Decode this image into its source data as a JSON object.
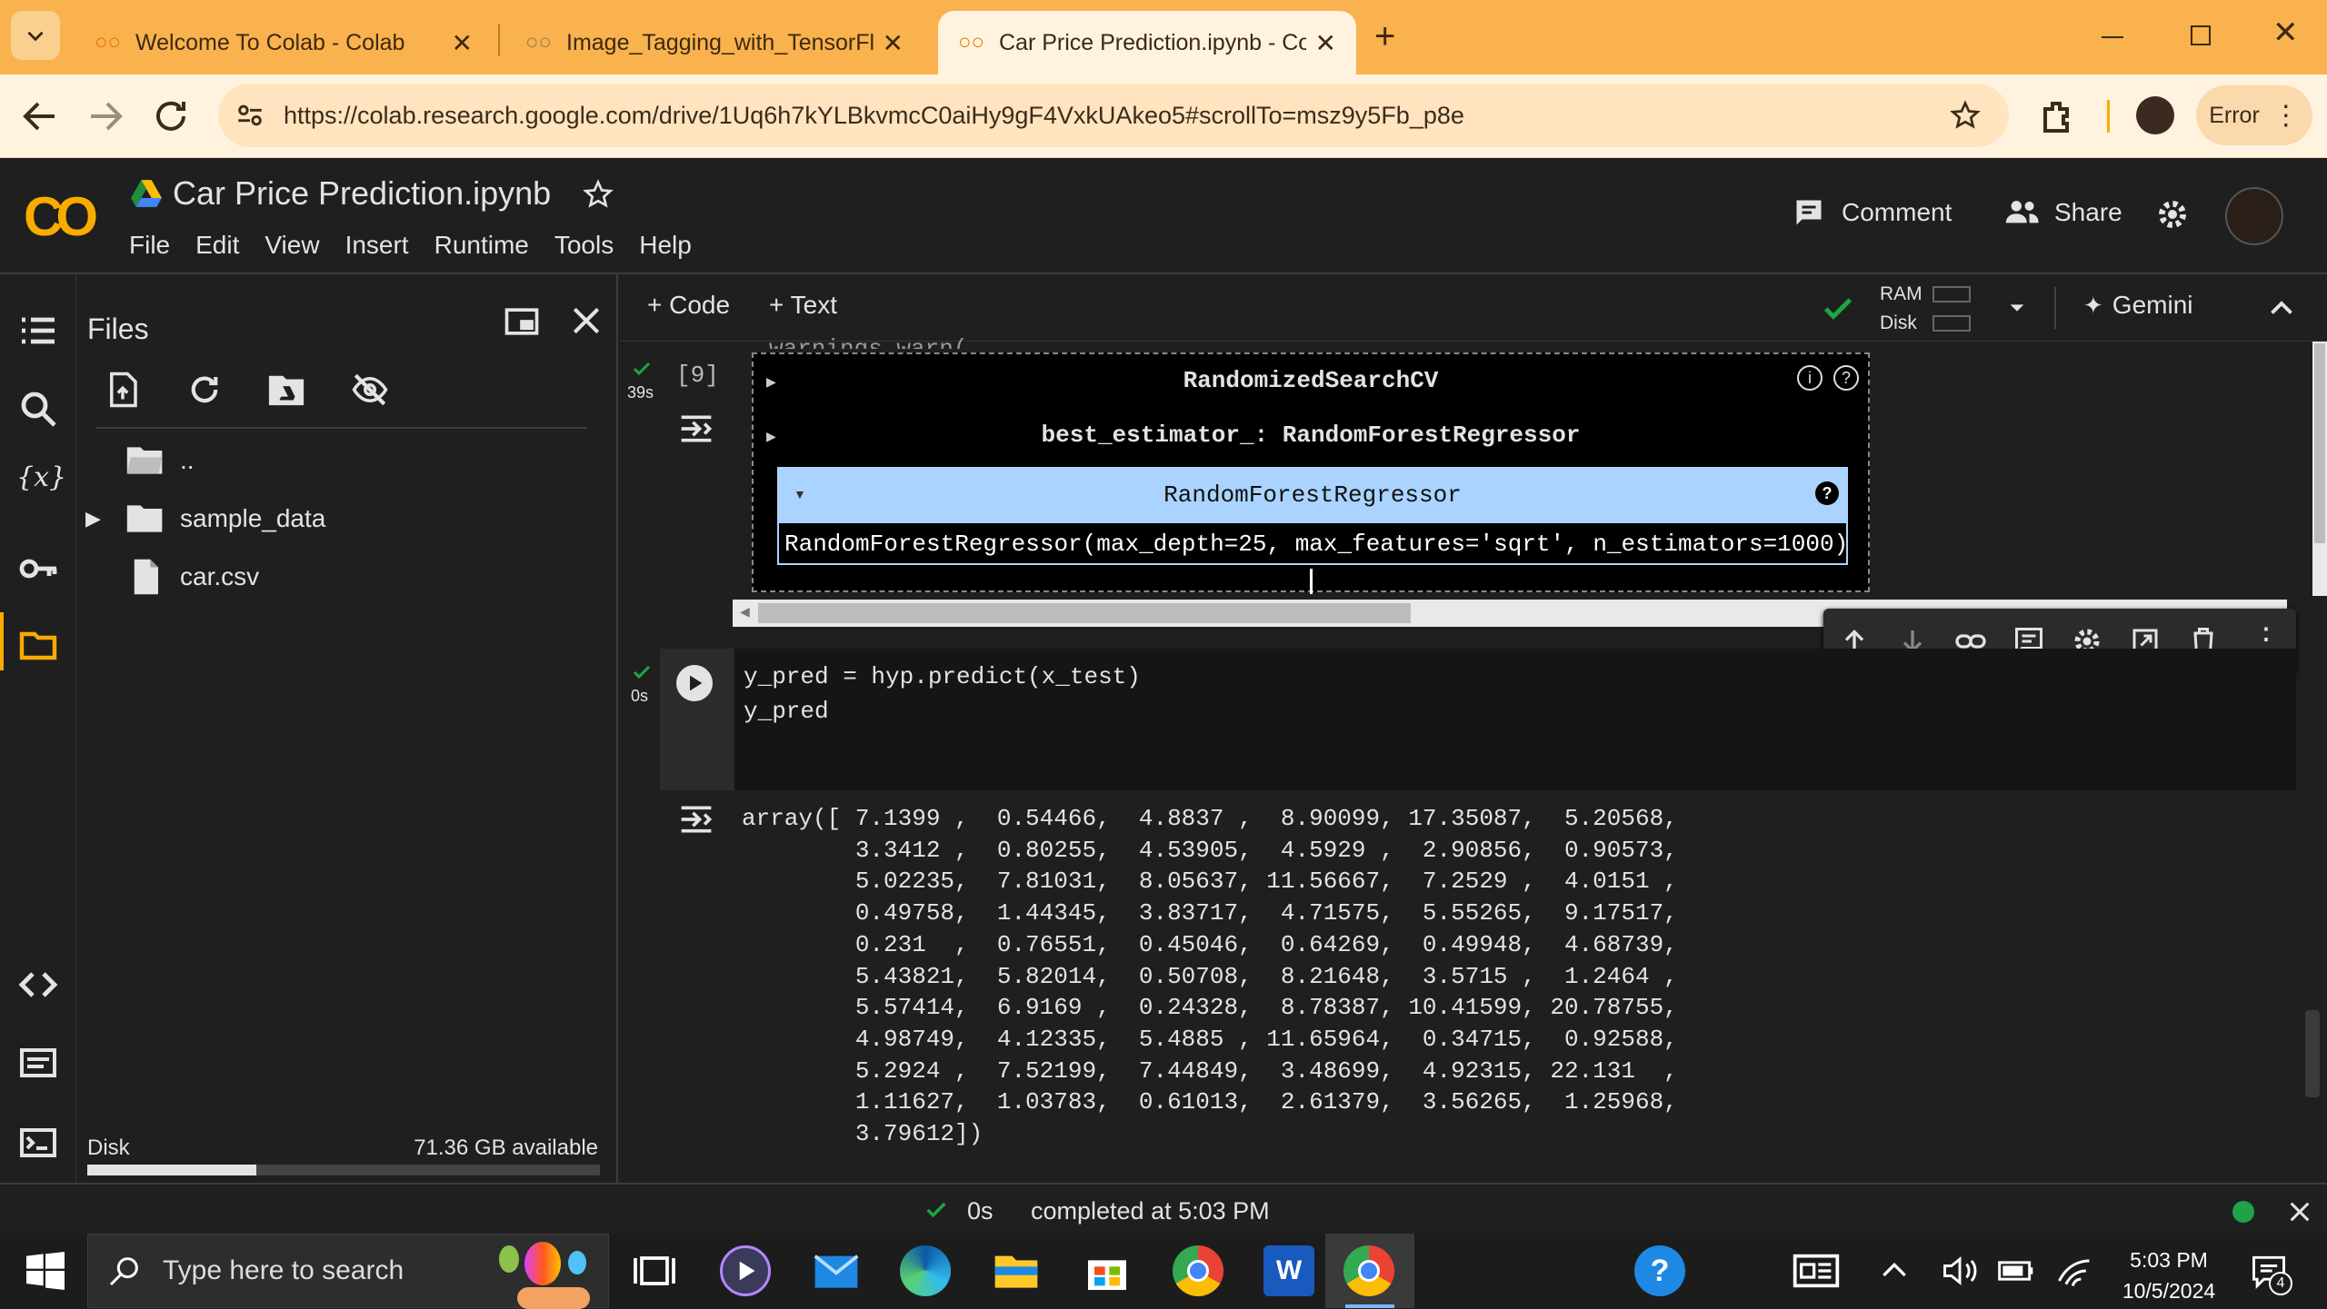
{
  "browser": {
    "tabs": [
      {
        "title": "Welcome To Colab - Colab"
      },
      {
        "title": "Image_Tagging_with_TensorFlow"
      },
      {
        "title": "Car Price Prediction.ipynb - Colab",
        "active": true
      }
    ],
    "url": "https://colab.research.google.com/drive/1Uq6h7kYLBkvmcC0aiHy9gF4VxkUAkeo5#scrollTo=msz9y5Fb_p8e",
    "error_label": "Error"
  },
  "colab": {
    "logo": "CO",
    "title": "Car Price Prediction.ipynb",
    "menu": [
      "File",
      "Edit",
      "View",
      "Insert",
      "Runtime",
      "Tools",
      "Help"
    ],
    "comment_label": "Comment",
    "share_label": "Share"
  },
  "files": {
    "title": "Files",
    "items": [
      {
        "name": ".."
      },
      {
        "name": "sample_data"
      },
      {
        "name": "car.csv"
      }
    ],
    "disk_label": "Disk",
    "disk_available": "71.36 GB available",
    "disk_used_fraction": 0.33
  },
  "notebook": {
    "add_code": "Code",
    "add_text": "Text",
    "ram_label": "RAM",
    "disk_label": "Disk",
    "gemini_label": "Gemini",
    "cell9": {
      "exec_count": "[9]",
      "time": "39s",
      "partial_line": "warnings.warn(",
      "estimator_title": "RandomizedSearchCV",
      "best_estimator": "best_estimator_: RandomForestRegressor",
      "inner_title": "RandomForestRegressor",
      "params": "RandomForestRegressor(max_depth=25, max_features='sqrt', n_estimators=1000)"
    },
    "cell10": {
      "time": "0s",
      "code_line1": "y_pred = hyp.predict(x_test)",
      "code_line2": "y_pred",
      "output": "array([ 7.1399 ,  0.54466,  4.8837 ,  8.90099, 17.35087,  5.20568,\n        3.3412 ,  0.80255,  4.53905,  4.5929 ,  2.90856,  0.90573,\n        5.02235,  7.81031,  8.05637, 11.56667,  7.2529 ,  4.0151 ,\n        0.49758,  1.44345,  3.83717,  4.71575,  5.55265,  9.17517,\n        0.231  ,  0.76551,  0.45046,  0.64269,  0.49948,  4.68739,\n        5.43821,  5.82014,  0.50708,  8.21648,  3.5715 ,  1.2464 ,\n        5.57414,  6.9169 ,  0.24328,  8.78387, 10.41599, 20.78755,\n        4.98749,  4.12335,  5.4885 , 11.65964,  0.34715,  0.92588,\n        5.2924 ,  7.52199,  7.44849,  3.48699,  4.92315, 22.131  ,\n        1.11627,  1.03783,  0.61013,  2.61379,  3.56265,  1.25968,\n        3.79612])"
    }
  },
  "statusbar": {
    "time": "0s",
    "text": "completed at 5:03 PM"
  },
  "taskbar": {
    "search_placeholder": "Type here to search",
    "clock_time": "5:03 PM",
    "clock_date": "10/5/2024",
    "notif_count": "4"
  },
  "colors": {
    "chrome_orange": "#f9b24e",
    "colab_orange": "#f9ab00",
    "check_green": "#1ea446",
    "selected_blue": "#aad4ff"
  }
}
